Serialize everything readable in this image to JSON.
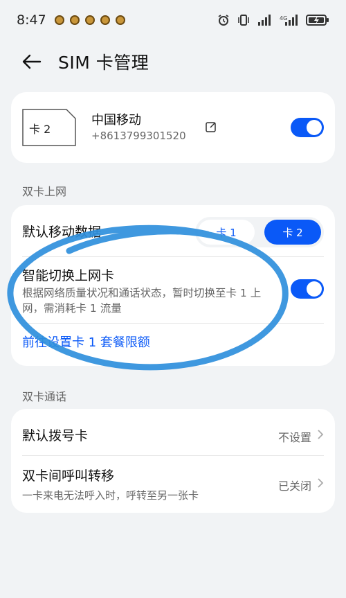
{
  "status_bar": {
    "time": "8:47"
  },
  "header": {
    "title": "SIM 卡管理"
  },
  "sim_card": {
    "icon_label": "卡 2",
    "carrier": "中国移动",
    "phone": "+8613799301520",
    "enabled": true
  },
  "sections": {
    "dual_data": "双卡上网",
    "dual_call": "双卡通话"
  },
  "data_card": {
    "default_data_label": "默认移动数据",
    "segment": [
      "卡 1",
      "卡 2"
    ],
    "selected_segment": "卡 2",
    "smart_switch_label": "智能切换上网卡",
    "smart_switch_desc": "根据网络质量状况和通话状态，暂时切换至卡 1 上网，需消耗卡 1 流量",
    "smart_switch_enabled": true,
    "link": "前往设置卡 1 套餐限额"
  },
  "call_card": {
    "default_dial_label": "默认拨号卡",
    "default_dial_value": "不设置",
    "forward_label": "双卡间呼叫转移",
    "forward_desc": "一卡来电无法呼入时，呼转至另一张卡",
    "forward_value": "已关闭"
  },
  "colors": {
    "accent": "#0a59f7",
    "annotation": "#2f8fdc"
  }
}
